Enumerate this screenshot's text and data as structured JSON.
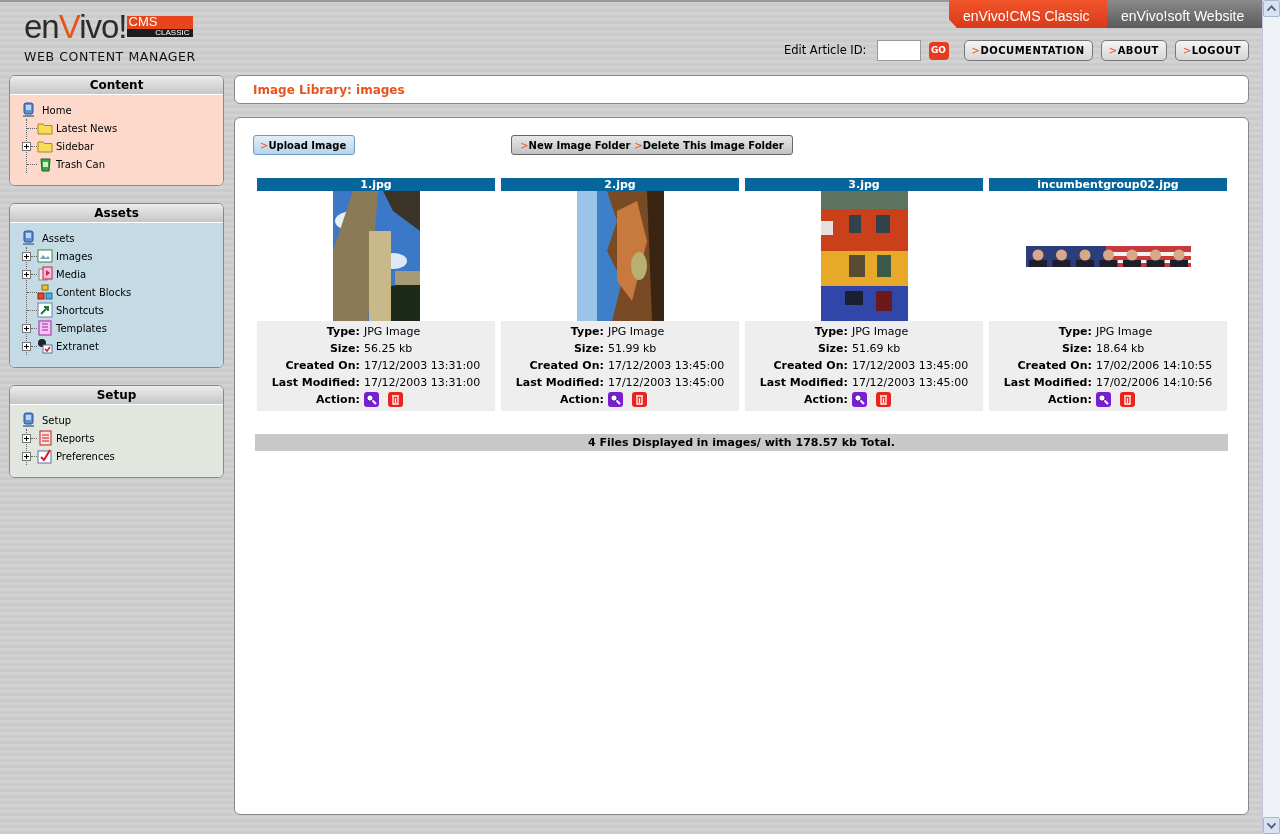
{
  "header": {
    "logo": {
      "brand": [
        "en",
        "V",
        "ivo!"
      ],
      "badge_top": "CMS",
      "badge_bottom": "CLASSIC",
      "tagline": "WEB CONTENT MANAGER"
    },
    "site_tabs": [
      {
        "label": "enVivo!CMS Classic",
        "selected": true
      },
      {
        "label": "enVivo!soft Website",
        "selected": false
      }
    ],
    "article_id": {
      "label": "Edit Article ID:",
      "go": "GO"
    },
    "nav_buttons": [
      {
        "marker": ">",
        "label": "DOCUMENTATION"
      },
      {
        "marker": ">",
        "label": "ABOUT"
      },
      {
        "marker": ">",
        "label": "LOGOUT"
      }
    ]
  },
  "sidebar": [
    {
      "title": "Content",
      "color": "#fdd9cc",
      "tree": {
        "label": "Home",
        "kind": "root",
        "children": [
          {
            "label": "Latest News",
            "kind": "folder"
          },
          {
            "label": "Sidebar",
            "kind": "folder",
            "expanded": false
          },
          {
            "label": "Trash Can",
            "kind": "trash"
          }
        ]
      }
    },
    {
      "title": "Assets",
      "color": "#c4dbe5",
      "tree": {
        "label": "Assets",
        "kind": "root",
        "children": [
          {
            "label": "Images",
            "kind": "images",
            "expanded": false
          },
          {
            "label": "Media",
            "kind": "media",
            "expanded": false
          },
          {
            "label": "Content Blocks",
            "kind": "blocks"
          },
          {
            "label": "Shortcuts",
            "kind": "shortcut"
          },
          {
            "label": "Templates",
            "kind": "templates",
            "expanded": false
          },
          {
            "label": "Extranet",
            "kind": "extranet",
            "expanded": false
          }
        ]
      }
    },
    {
      "title": "Setup",
      "color": "#e1e7de",
      "tree": {
        "label": "Setup",
        "kind": "root",
        "children": [
          {
            "label": "Reports",
            "kind": "reports",
            "expanded": false
          },
          {
            "label": "Preferences",
            "kind": "preferences",
            "expanded": false
          }
        ]
      }
    }
  ],
  "main": {
    "title": "Image Library: images",
    "upload_button": {
      "marker": ">",
      "label": "Upload Image"
    },
    "folder_buttons": [
      {
        "marker": ">",
        "label": "New Image Folder"
      },
      {
        "marker": ">",
        "label": "Delete This Image Folder"
      }
    ],
    "files": [
      {
        "name": "1.jpg",
        "kind": "picture",
        "details": [
          {
            "label": "Type:",
            "value": "JPG Image"
          },
          {
            "label": "Size:",
            "value": "56.25 kb"
          },
          {
            "label": "Created On:",
            "value": "17/12/2003 13:31:00"
          },
          {
            "label": "Last Modified:",
            "value": "17/12/2003 13:31:00"
          }
        ],
        "action_label": "Action:"
      },
      {
        "name": "2.jpg",
        "kind": "picture",
        "details": [
          {
            "label": "Type:",
            "value": "JPG Image"
          },
          {
            "label": "Size:",
            "value": "51.99 kb"
          },
          {
            "label": "Created On:",
            "value": "17/12/2003 13:45:00"
          },
          {
            "label": "Last Modified:",
            "value": "17/12/2003 13:45:00"
          }
        ],
        "action_label": "Action:"
      },
      {
        "name": "3.jpg",
        "kind": "picture",
        "details": [
          {
            "label": "Type:",
            "value": "JPG Image"
          },
          {
            "label": "Size:",
            "value": "51.69 kb"
          },
          {
            "label": "Created On:",
            "value": "17/12/2003 13:45:00"
          },
          {
            "label": "Last Modified:",
            "value": "17/12/2003 13:45:00"
          }
        ],
        "action_label": "Action:"
      },
      {
        "name": "incumbentgroup02.jpg",
        "kind": "picture",
        "details": [
          {
            "label": "Type:",
            "value": "JPG Image"
          },
          {
            "label": "Size:",
            "value": "18.64 kb"
          },
          {
            "label": "Created On:",
            "value": "17/02/2006 14:10:55"
          },
          {
            "label": "Last Modified:",
            "value": "17/02/2006 14:10:56"
          }
        ],
        "action_label": "Action:"
      }
    ],
    "summary": "4 Files Displayed in images/ with 178.57 kb Total."
  }
}
